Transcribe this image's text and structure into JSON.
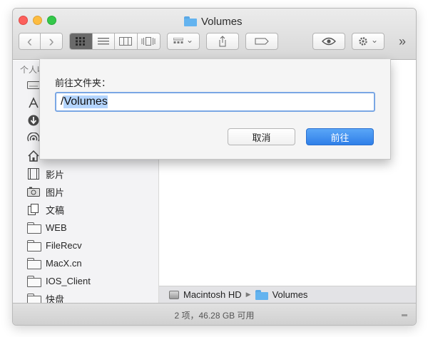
{
  "window": {
    "title": "Volumes"
  },
  "toolbar": {
    "back_glyph": "‹",
    "forward_glyph": "›",
    "share_glyph": "⇪",
    "overflow_glyph": "»",
    "chevron_glyph": "⌄"
  },
  "sidebar": {
    "header": "个人收藏",
    "items": [
      {
        "label": "",
        "icon": "drive-icon"
      },
      {
        "label": "",
        "icon": "applications-icon"
      },
      {
        "label": "",
        "icon": "downloads-icon"
      },
      {
        "label": "",
        "icon": "airdrop-icon"
      },
      {
        "label": "",
        "icon": "home-icon"
      },
      {
        "label": "影片",
        "icon": "movies-icon"
      },
      {
        "label": "图片",
        "icon": "pictures-icon"
      },
      {
        "label": "文稿",
        "icon": "documents-icon"
      },
      {
        "label": "WEB",
        "icon": "folder-icon"
      },
      {
        "label": "FileRecv",
        "icon": "folder-icon"
      },
      {
        "label": "MacX.cn",
        "icon": "folder-icon"
      },
      {
        "label": "IOS_Client",
        "icon": "folder-icon"
      },
      {
        "label": "快盘",
        "icon": "folder-icon"
      }
    ]
  },
  "pathbar": {
    "crumbs": [
      "Macintosh HD",
      "Volumes"
    ],
    "separator": "▶"
  },
  "statusbar": {
    "text": "2 项，46.28 GB 可用"
  },
  "go_to_folder_sheet": {
    "label": "前往文件夹：",
    "input_value_prefix": "/",
    "input_value_selected": "Volumes",
    "cancel_label": "取消",
    "go_label": "前往"
  },
  "colors": {
    "accent": "#2f7fe8",
    "folder_blue": "#63b3ef",
    "selection": "#b4d5fe"
  }
}
